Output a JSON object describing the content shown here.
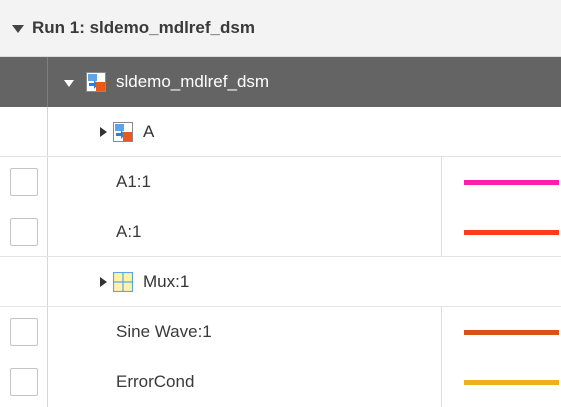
{
  "run": {
    "title": "Run 1: sldemo_mdlref_dsm"
  },
  "model": {
    "name": "sldemo_mdlref_dsm",
    "icon": "model-reference-icon"
  },
  "subsystems": [
    {
      "label": "A",
      "icon": "model-reference-icon"
    },
    {
      "label": "Mux:1",
      "icon": "mux-grid-icon"
    }
  ],
  "signals": [
    {
      "label": "A1:1",
      "color": "#ff1fa8",
      "checked": false
    },
    {
      "label": "A:1",
      "color": "#ff3b1f",
      "checked": false
    },
    {
      "label": "Sine Wave:1",
      "color": "#d95319",
      "checked": false
    },
    {
      "label": "ErrorCond",
      "color": "#edb120",
      "checked": false
    }
  ]
}
